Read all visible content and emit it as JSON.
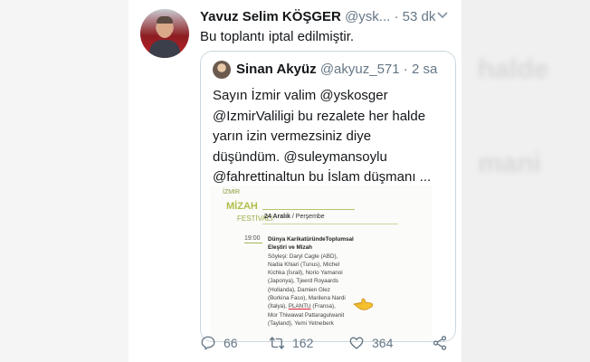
{
  "background": {
    "blur_text_1": "halde",
    "blur_text_2": "mani"
  },
  "tweet": {
    "author_name": "Yavuz Selim KÖŞGER",
    "author_handle": "@ysk...",
    "separator": "·",
    "timestamp": "53 dk",
    "text": "Bu toplantı iptal edilmiştir.",
    "quoted": {
      "author_name": "Sinan Akyüz",
      "author_handle": "@akyuz_571",
      "separator": "·",
      "timestamp": "2 sa",
      "lines": [
        "Sayın İzmir valim @yskosger",
        "@IzmirValiligi bu rezalete her halde",
        "yarın izin vermezsiniz diye",
        "düşündüm. @suleymansoylu",
        "@fahrettinaltun bu İslam düşmanı ..."
      ],
      "image": {
        "top_label": "İZMİR",
        "festival_word": "MİZAH",
        "festival_sub": "FESTİVALİ",
        "date": "24 Aralık",
        "day": "Perşembe",
        "hour": "19:00",
        "title_lines": [
          "Dünya KarikatüründeToplumsal",
          "Eleştiri ve Mizah"
        ],
        "body_lines": [
          "Söyleşi: Daryl Cagle (ABD),",
          "Nadia Khiari (Tunus), Michel",
          "Kichka (İsrail), Norio Yamanoi",
          "(Japonya), Tjeerd Royaards",
          "(Hollanda), Damien Glez",
          "(Burkina Faso), Marilena Nardi",
          "(İtalya),",
          "Mor Thiwawat Pattaragulwanit",
          "(Tayland), Yemi Yetneberk"
        ],
        "highlight_name": "PLANTU",
        "highlight_suffix": "(Fransa),"
      }
    },
    "actions": {
      "replies": "66",
      "retweets": "162",
      "likes": "364"
    }
  },
  "colors": {
    "name_text": "#14171a",
    "muted": "#657786",
    "border": "#ccd6dd",
    "poster_green": "#b3be4a"
  },
  "icons": [
    "caret-down-icon",
    "reply-icon",
    "retweet-icon",
    "like-icon",
    "share-icon",
    "pointing-hand-icon"
  ]
}
